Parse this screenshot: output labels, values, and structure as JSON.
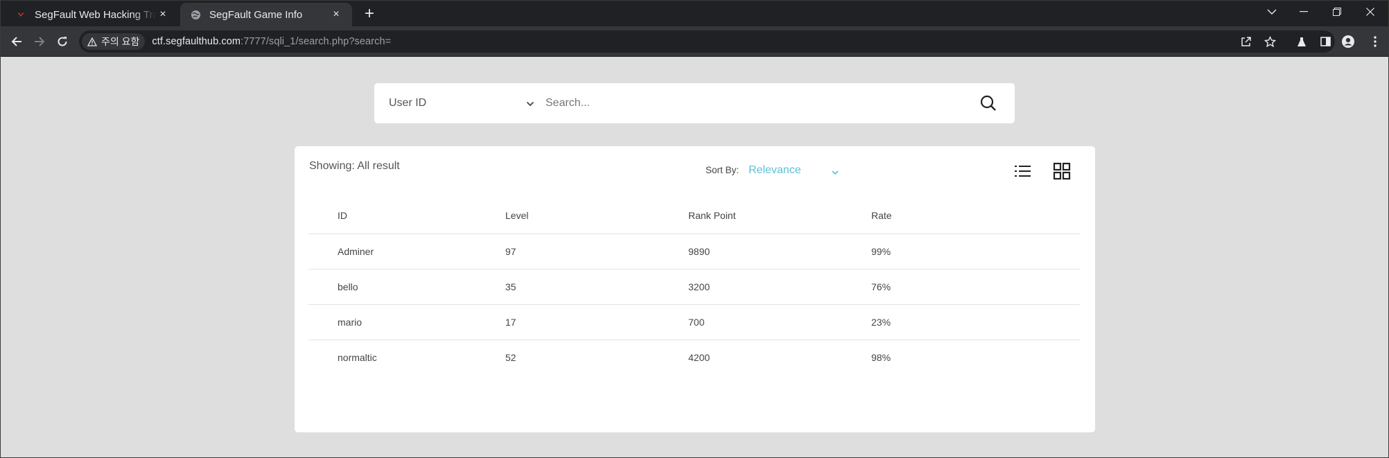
{
  "browser": {
    "tabs": [
      {
        "title": "SegFault Web Hacking Training",
        "favicon": "segfault-logo-icon",
        "active": false
      },
      {
        "title": "SegFault Game Info",
        "favicon": "globe-icon",
        "active": true
      }
    ],
    "close_glyph": "×",
    "new_tab_glyph": "+",
    "window_controls": [
      "tab-search-icon",
      "minimize-icon",
      "restore-icon",
      "close-icon"
    ],
    "security_chip": "주의 요함",
    "url_host": "ctf.segfaulthub.com",
    "url_path": ":7777/sqli_1/search.php?search=",
    "toolbar_icons": [
      "share-icon",
      "bookmark-star-icon",
      "labs-icon",
      "side-panel-icon",
      "profile-icon",
      "menu-icon"
    ]
  },
  "search": {
    "field_select": "User ID",
    "placeholder": "Search...",
    "value": ""
  },
  "results": {
    "showing": "Showing: All result",
    "sort_label": "Sort By:",
    "sort_value": "Relevance",
    "accent_color": "#5cc0d5",
    "columns": [
      "ID",
      "Level",
      "Rank Point",
      "Rate"
    ],
    "rows": [
      [
        "Adminer",
        "97",
        "9890",
        "99%"
      ],
      [
        "bello",
        "35",
        "3200",
        "76%"
      ],
      [
        "mario",
        "17",
        "700",
        "23%"
      ],
      [
        "normaltic",
        "52",
        "4200",
        "98%"
      ]
    ]
  }
}
